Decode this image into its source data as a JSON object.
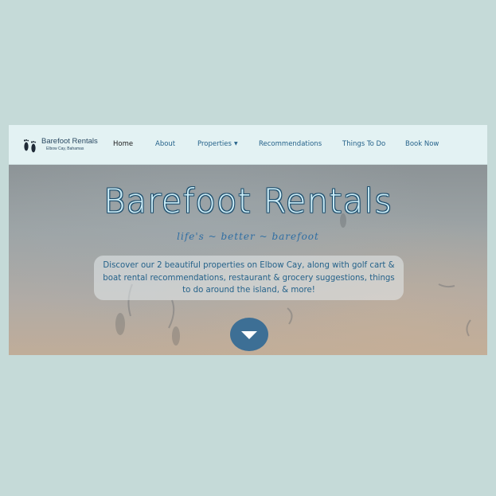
{
  "brand": {
    "name": "Barefoot Rentals",
    "subtitle": "Elbow Cay, Bahamas",
    "logo_icon": "footprints-icon"
  },
  "nav": {
    "items": [
      {
        "label": "Home",
        "active": true
      },
      {
        "label": "About"
      },
      {
        "label": "Properties",
        "has_dropdown": true
      },
      {
        "label": "Recommendations"
      },
      {
        "label": "Things To Do"
      },
      {
        "label": "Book Now"
      }
    ]
  },
  "hero": {
    "title": "Barefoot Rentals",
    "tagline": "life's ~ better ~ barefoot",
    "intro": "Discover our 2 beautiful properties on Elbow Cay, along with golf cart & boat rental recommendations, restaurant & grocery suggestions, things to do around the island, & more!",
    "scroll_icon": "chevron-down-icon"
  },
  "colors": {
    "page_bg": "#c5dad8",
    "nav_bg": "#e3f2f3",
    "nav_link": "#25628a",
    "title_fill": "#cdeef8",
    "scroll_button": "#3d6f95"
  }
}
